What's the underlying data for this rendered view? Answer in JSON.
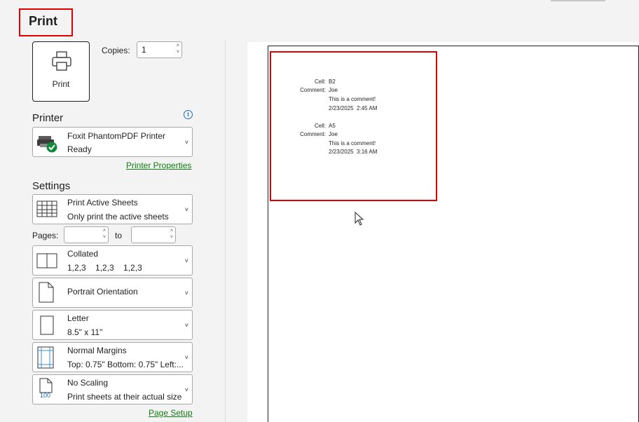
{
  "header": {
    "title": "Print"
  },
  "print_button": {
    "label": "Print",
    "icon": "printer-icon"
  },
  "copies": {
    "label": "Copies:",
    "value": "1"
  },
  "printer": {
    "heading": "Printer",
    "name": "Foxit PhantomPDF Printer",
    "status": "Ready",
    "properties_link": "Printer Properties"
  },
  "settings": {
    "heading": "Settings",
    "active_sheets": {
      "title": "Print Active Sheets",
      "subtitle": "Only print the active sheets"
    },
    "pages": {
      "label": "Pages:",
      "to_label": "to",
      "from_value": "",
      "to_value": ""
    },
    "collated": {
      "title": "Collated",
      "subtitle": "1,2,3    1,2,3    1,2,3"
    },
    "orientation": {
      "title": "Portrait Orientation"
    },
    "paper": {
      "title": "Letter",
      "subtitle": "8.5\" x 11\""
    },
    "margins": {
      "title": "Normal Margins",
      "subtitle": "Top: 0.75\" Bottom: 0.75\" Left:..."
    },
    "scaling": {
      "title": "No Scaling",
      "subtitle": "Print sheets at their actual size",
      "icon_text": "100"
    },
    "page_setup_link": "Page Setup"
  },
  "preview": {
    "comments": [
      {
        "cell_label": "Cell:",
        "cell": "B2",
        "comment_label": "Comment:",
        "author": "Joe",
        "text": "This is a comment!",
        "date": "2/23/2025  2:45 AM"
      },
      {
        "cell_label": "Cell:",
        "cell": "A5",
        "comment_label": "Comment:",
        "author": "Joe",
        "text": "This is a comment!",
        "date": "2/23/2025  3:16 AM"
      }
    ]
  },
  "colors": {
    "highlight": "#e00000",
    "link": "#107c10",
    "info": "#1f6fb8"
  }
}
